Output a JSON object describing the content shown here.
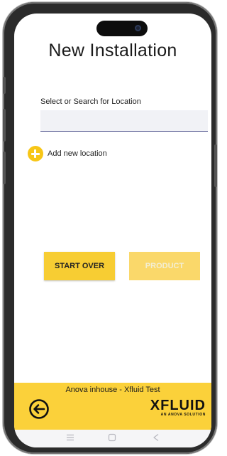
{
  "header": {
    "title": "New Installation"
  },
  "location": {
    "label": "Select or Search for Location",
    "input_value": "",
    "add_label": "Add new location"
  },
  "actions": {
    "start_over": "START OVER",
    "product": "PRODUCT",
    "product_enabled": false
  },
  "footer": {
    "account": "Anova inhouse - Xfluid Test",
    "logo_main": "XFLUID",
    "logo_sub": "AN ANOVA SOLUTION"
  },
  "icons": [
    "camera-icon",
    "add-icon",
    "back-arrow-icon",
    "menu-icon",
    "home-icon",
    "back-icon"
  ],
  "colors": {
    "accent": "#f7cd33",
    "accent_disabled": "#fad86a"
  }
}
